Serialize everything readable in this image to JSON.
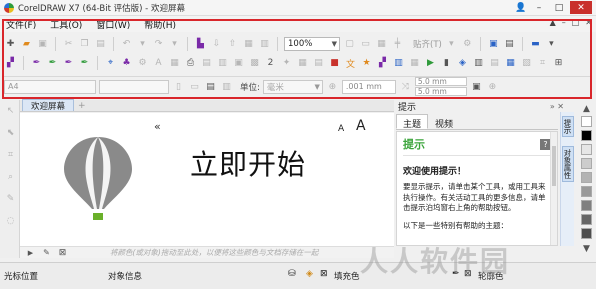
{
  "window": {
    "title": "CorelDRAW X7 (64-Bit 评估版) - 欢迎屏幕",
    "controls": {
      "user": "👤",
      "minimize": "–",
      "maximize": "□",
      "close": "✕"
    }
  },
  "menu": {
    "items": [
      "文件(F)",
      "工具(O)",
      "窗口(W)",
      "帮助(H)"
    ],
    "right_controls": [
      "▲",
      "–",
      "□",
      "✕"
    ]
  },
  "toolbar": {
    "zoom_value": "100%",
    "snap_label": "贴齐(T)",
    "page_preset": "A4",
    "units_label": "单位:",
    "units_value": "毫米",
    "nudge_value": ".001 mm",
    "dup_x": "5.0 mm",
    "dup_y": "5.0 mm"
  },
  "document": {
    "tab_label": "欢迎屏幕",
    "add_tab": "+",
    "collapse": "«",
    "font_small": "A",
    "font_large": "A",
    "heading": "立即开始",
    "drop_hint": "将颜色(或对象)拖动至此处，以便将这些颜色与文档存储在一起"
  },
  "hints_panel": {
    "panel_title": "提示",
    "tabs": [
      "主题",
      "视频"
    ],
    "heading": "提示",
    "help_icon": "?",
    "welcome": "欢迎使用提示！",
    "paragraph": "要显示提示，请单击某个工具，或用工具来执行操作。有关活动工具的更多信息，请单击提示泊坞窗右上角的帮助按钮。",
    "topics_line": "以下是一些特别有帮助的主题："
  },
  "docker_tabs": [
    "提示",
    "对象属性"
  ],
  "status": {
    "cursor_position": "光标位置",
    "object_info": "对象信息",
    "fill_label": "填充色",
    "outline_label": "轮廓色"
  },
  "watermark": "人人软件园",
  "colors": {
    "accent_red": "#d9262b",
    "hint_green": "#3aa43a",
    "balloon_gray": "#8a8a8a",
    "basket_green": "#6ab02a"
  }
}
